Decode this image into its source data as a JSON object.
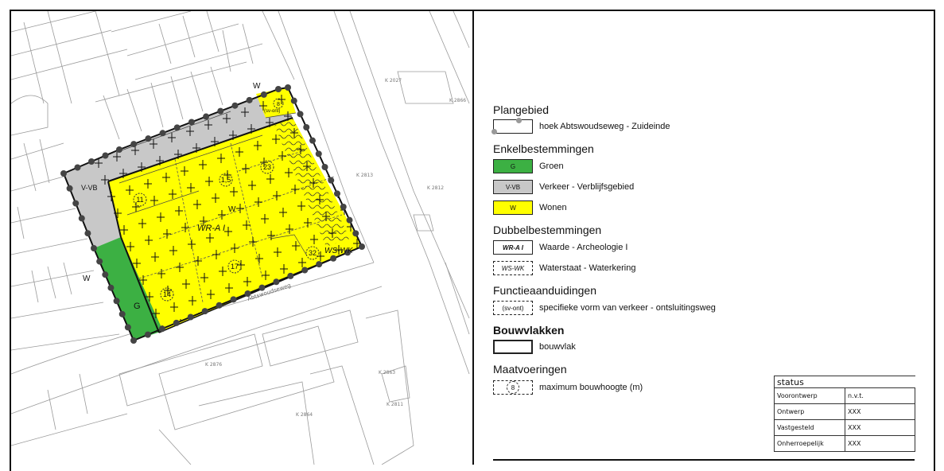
{
  "map": {
    "zones": {
      "verblijf": "V-VB",
      "groen": "G",
      "wonen": "W",
      "archeologie": "WR-A I",
      "waterkering": "WS-WK",
      "w_top": "W",
      "w_left": "W",
      "sv_ont": "(sv-ont)"
    },
    "heights": [
      "1,5",
      "23",
      "11",
      "17",
      "14",
      "32",
      "8"
    ],
    "street_label": "Abtswoudseweg",
    "parcel_labels": [
      "K 2027",
      "K 2866",
      "K 2813",
      "K 2812",
      "K 2876",
      "K 2863",
      "K 2864",
      "K 2811"
    ],
    "colors": {
      "wonen": "#ffff00",
      "verkeer": "#c8c8c8",
      "groen": "#3cb043",
      "background_lines": "#9a9a9a",
      "dots": "#444444"
    }
  },
  "legend": {
    "sections": {
      "plangebied": "Plangebied",
      "enkel": "Enkelbestemmingen",
      "dubbel": "Dubbelbestemmingen",
      "functie": "Functieaanduidingen",
      "bouwvlakken": "Bouwvlakken",
      "maat": "Maatvoeringen"
    },
    "items": {
      "plangebied": "hoek Abtswoudseweg - Zuideinde",
      "groen_code": "G",
      "groen": "Groen",
      "verkeer_code": "V-VB",
      "verkeer": "Verkeer - Verblijfsgebied",
      "wonen_code": "W",
      "wonen": "Wonen",
      "waarde_code": "WR-A I",
      "waarde": "Waarde - Archeologie I",
      "waterstaat_code": "WS-WK",
      "waterstaat": "Waterstaat - Waterkering",
      "functie_code": "(sv-ont)",
      "functie": "specifieke vorm van verkeer - ontsluitingsweg",
      "bouwvlak": "bouwvlak",
      "maat_code": "8",
      "maat": "maximum bouwhoogte (m)"
    }
  },
  "status": {
    "title": "status",
    "rows": [
      {
        "label": "Voorontwerp",
        "value": "n.v.t."
      },
      {
        "label": "Ontwerp",
        "value": "XXX"
      },
      {
        "label": "Vastgesteld",
        "value": "XXX"
      },
      {
        "label": "Onherroepelijk",
        "value": "XXX"
      }
    ]
  }
}
